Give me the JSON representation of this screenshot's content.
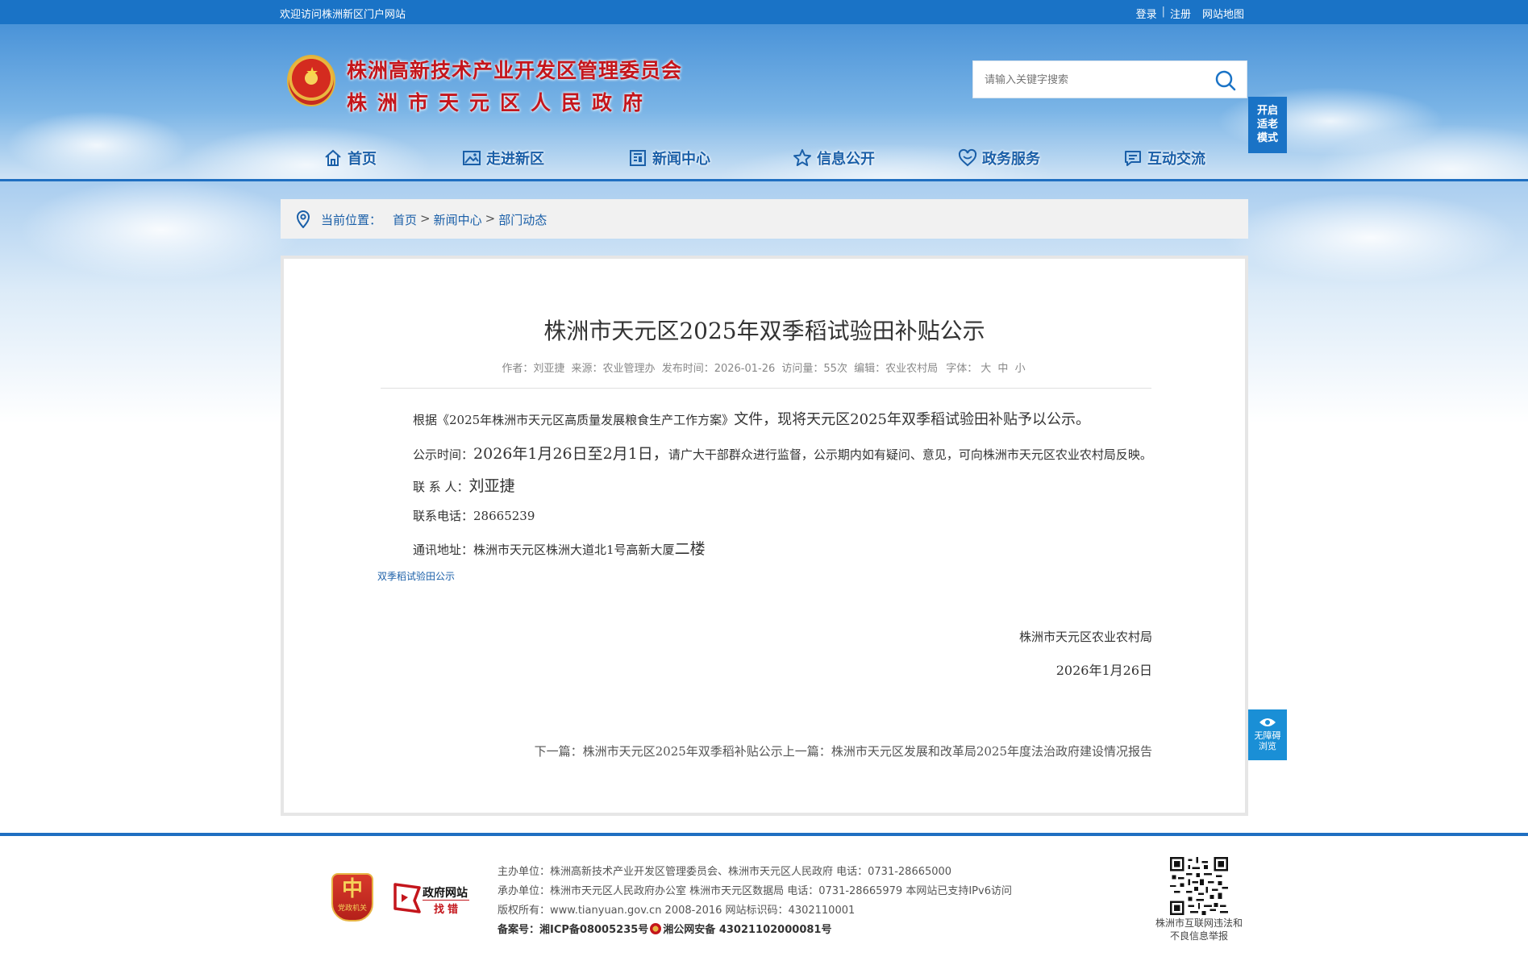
{
  "topbar": {
    "welcome": "欢迎访问株洲新区门户网站",
    "login": "登录",
    "separator": "|",
    "register": "注册",
    "sitemap": "网站地图"
  },
  "header": {
    "title_line1": "株洲高新技术产业开发区管理委员会",
    "title_line2": "株洲市天元区人民政府",
    "search_placeholder": "请输入关键字搜索",
    "elder_mode": "开启适老模式"
  },
  "nav": [
    {
      "label": "首页",
      "icon": "home-icon"
    },
    {
      "label": "走进新区",
      "icon": "picture-icon"
    },
    {
      "label": "新闻中心",
      "icon": "newspaper-icon"
    },
    {
      "label": "信息公开",
      "icon": "star-icon"
    },
    {
      "label": "政务服务",
      "icon": "heart-icon"
    },
    {
      "label": "互动交流",
      "icon": "chat-icon"
    }
  ],
  "breadcrumb": {
    "label": "当前位置：",
    "items": [
      "首页",
      "新闻中心",
      "部门动态"
    ],
    "separator": ">"
  },
  "article": {
    "title": "株洲市天元区2025年双季稻试验田补贴公示",
    "meta": {
      "author": "作者：刘亚捷",
      "source": "来源：农业管理办",
      "date": "发布时间：2026-01-26",
      "views": "访问量：55次",
      "editor": "编辑：农业农村局",
      "font_label": "字体：",
      "font_large": "大",
      "font_medium": "中",
      "font_small": "小"
    },
    "p1_a": "根据《2025年株洲市天元区高质量发展粮食生产工作方案》",
    "p1_b": "文件，现将天元区2025年双季稻试验田补贴予以公示。",
    "p2_label": "公示时间：",
    "p2_a": "2026年1月26日至2月1日，",
    "p2_b": "请广大干部群众进行监督，公示期内如有疑问、意见，可向株洲市天元区农业农村局反映。",
    "p3_label": "联 系 人：",
    "p3_value": "刘亚捷",
    "p4_label": "联系电话：",
    "p4_value": "28665239",
    "p5_label": "通讯地址：",
    "p5_a": "株洲市天元区株洲大道北1号高新大厦",
    "p5_b": "二楼",
    "attachment": "双季稻试验田公示",
    "sign_org": "株洲市天元区农业农村局",
    "sign_date": "2026年1月26日",
    "next_label": "下一篇：",
    "next_title": "株洲市天元区2025年双季稻补贴公示",
    "prev_label": "上一篇：",
    "prev_title": "株洲市天元区发展和改革局2025年度法治政府建设情况报告"
  },
  "a11y_button": "无障碍浏览",
  "footer": {
    "party_badge": "党政机关",
    "party_glyph": "中",
    "gov_find_1": "政府网站",
    "gov_find_2": "找错",
    "line1": "主办单位：株洲高新技术产业开发区管理委员会、株洲市天元区人民政府 电话：0731-28665000",
    "line2": "承办单位：株洲市天元区人民政府办公室 株洲市天元区数据局 电话：0731-28665979 本网站已支持IPv6访问",
    "line3": "版权所有：www.tianyuan.gov.cn 2008-2016 网站标识码：4302110001",
    "line4_label": "备案号：",
    "line4_icp": "湘ICP备08005235号",
    "line4_police": "湘公网安备 43021102000081号",
    "qr_text": "株洲市互联网违法和不良信息举报"
  },
  "colors": {
    "primary_blue": "#1a73c6",
    "title_red": "#c4161c",
    "link_blue": "#1a5fa8"
  }
}
